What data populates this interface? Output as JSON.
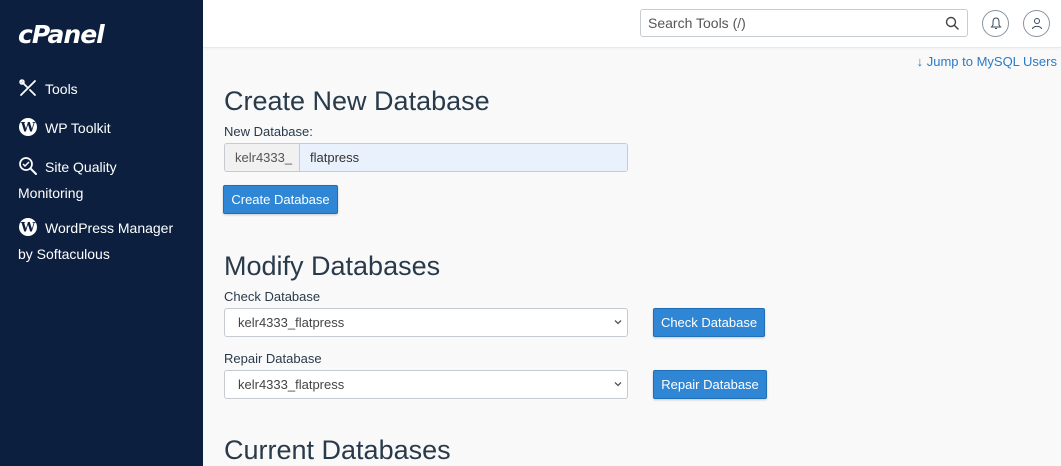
{
  "sidebar": {
    "logo": "cPanel",
    "items": [
      {
        "label": "Tools",
        "icon": "tools-icon"
      },
      {
        "label": "WP Toolkit",
        "icon": "wordpress-icon"
      },
      {
        "label_line1": "Site Quality",
        "label_line2": "Monitoring",
        "icon": "site-quality-icon"
      },
      {
        "label_line1": "WordPress Manager",
        "label_line2": "by Softaculous",
        "icon": "wordpress-icon"
      }
    ]
  },
  "header": {
    "search_placeholder": "Search Tools (/)"
  },
  "jump_link": "Jump to MySQL Users",
  "create": {
    "title": "Create New Database",
    "field_label": "New Database:",
    "prefix": "kelr4333_",
    "value": "flatpress",
    "button": "Create Database"
  },
  "modify": {
    "title": "Modify Databases",
    "check_label": "Check Database",
    "check_selected": "kelr4333_flatpress",
    "check_button": "Check Database",
    "repair_label": "Repair Database",
    "repair_selected": "kelr4333_flatpress",
    "repair_button": "Repair Database"
  },
  "current": {
    "title": "Current Databases"
  },
  "colors": {
    "sidebar_bg": "#0d1f3f",
    "primary_button": "#2e86d4",
    "link": "#2a7bc6"
  }
}
